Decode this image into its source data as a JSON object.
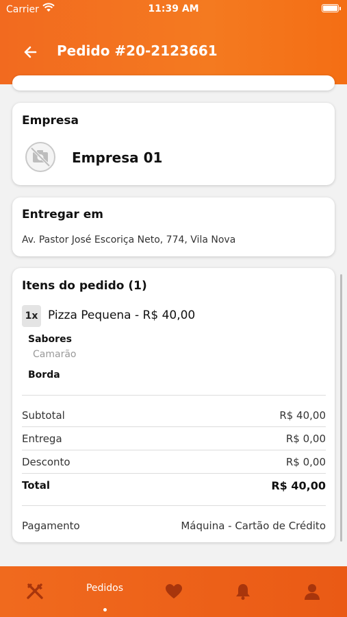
{
  "status_bar": {
    "carrier": "Carrier",
    "time": "11:39 AM"
  },
  "header": {
    "title": "Pedido #20-2123661",
    "back_icon": "arrow-left-icon"
  },
  "empresa": {
    "title": "Empresa",
    "name": "Empresa 01",
    "logo_icon": "no-image-icon"
  },
  "entregar": {
    "title": "Entregar em",
    "address": "Av. Pastor José Escoriça Neto, 774, Vila Nova"
  },
  "itens": {
    "title": "Itens do pedido (1)",
    "items": [
      {
        "qty": "1x",
        "name": "Pizza Pequena  - R$ 40,00",
        "options": [
          {
            "label": "Sabores",
            "value": "Camarão"
          },
          {
            "label": "Borda",
            "value": ""
          }
        ]
      }
    ],
    "summary": [
      {
        "label": "Subtotal",
        "value": "R$ 40,00"
      },
      {
        "label": "Entrega",
        "value": "R$ 0,00"
      },
      {
        "label": "Desconto",
        "value": "R$ 0,00"
      },
      {
        "label": "Total",
        "value": "R$ 40,00"
      }
    ],
    "payment": {
      "label": "Pagamento",
      "value": "Máquina - Cartão de Crédito"
    }
  },
  "tabbar": {
    "tabs": [
      {
        "icon": "fork-knife-icon",
        "label": ""
      },
      {
        "icon": "",
        "label": "Pedidos",
        "active": true
      },
      {
        "icon": "heart-icon",
        "label": ""
      },
      {
        "icon": "bell-icon",
        "label": ""
      },
      {
        "icon": "user-icon",
        "label": ""
      }
    ],
    "icon_color": "#a8350c"
  },
  "colors": {
    "accent": "#f47a20",
    "tab_icon": "#a8350c"
  }
}
